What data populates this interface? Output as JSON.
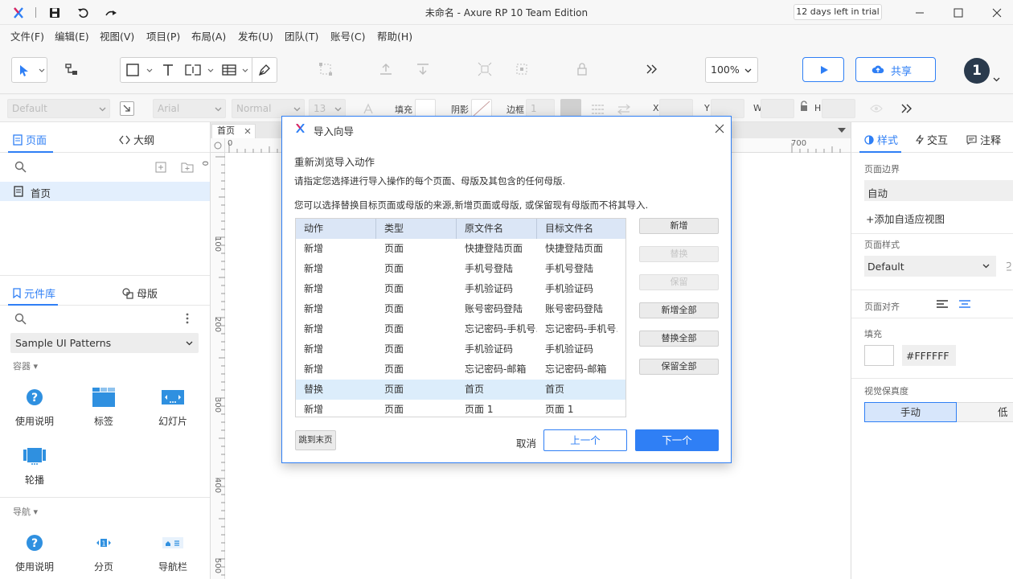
{
  "window": {
    "title": "未命名 - Axure RP 10 Team Edition",
    "trial": "12 days left in trial"
  },
  "menu": [
    "文件(F)",
    "编辑(E)",
    "视图(V)",
    "项目(P)",
    "布局(A)",
    "发布(U)",
    "团队(T)",
    "账号(C)",
    "帮助(H)"
  ],
  "toolbar": {
    "zoom": "100%",
    "share_label": "共享",
    "avatar_text": "1"
  },
  "style_toolbar": {
    "style_select": "Default",
    "font_select": "Arial",
    "weight_select": "Normal",
    "size_select": "13",
    "fill_label": "填充",
    "shadow_label": "阴影",
    "border_label": "边框",
    "border_value": "1",
    "x_label": "X",
    "y_label": "Y",
    "w_label": "W",
    "h_label": "H"
  },
  "left_panel": {
    "pages_tab": "页面",
    "outline_tab": "大纲",
    "pages": [
      "首页"
    ],
    "library_tab": "元件库",
    "masters_tab": "母版",
    "library_select": "Sample UI Patterns",
    "section_containers": "容器",
    "containers": [
      {
        "label": "使用说明",
        "icon": "help-circle-icon"
      },
      {
        "label": "标签",
        "icon": "tabs-icon"
      },
      {
        "label": "幻灯片",
        "icon": "slideshow-icon"
      },
      {
        "label": "轮播",
        "icon": "carousel-icon"
      }
    ],
    "section_nav": "导航",
    "nav_widgets": [
      {
        "label": "使用说明",
        "icon": "help-circle-icon"
      },
      {
        "label": "分页",
        "icon": "pagination-icon"
      },
      {
        "label": "导航栏",
        "icon": "navbar-icon"
      }
    ]
  },
  "canvas": {
    "page_tab": "首页",
    "ruler_h": [
      "0",
      "700"
    ],
    "ruler_v": [
      "0",
      "100",
      "200",
      "300",
      "400",
      "500"
    ]
  },
  "right_panel": {
    "tabs": [
      "样式",
      "交互",
      "注释"
    ],
    "page_bounds_label": "页面边界",
    "page_bounds_value": "自动",
    "add_adaptive_view": "+添加自适应视图",
    "page_style_label": "页面样式",
    "page_style_value": "Default",
    "page_align_label": "页面对齐",
    "fill_label": "填充",
    "fill_value": "#FFFFFF",
    "fidelity_label": "视觉保真度",
    "fidelity_options": [
      "手动",
      "低"
    ]
  },
  "dialog": {
    "title": "导入向导",
    "heading": "重新浏览导入动作",
    "desc1": "请指定您选择进行导入操作的每个页面、母版及其包含的任何母版.",
    "desc2": "您可以选择替换目标页面或母版的来源,新增页面或母版, 或保留现有母版而不将其导入.",
    "columns": [
      "动作",
      "类型",
      "原文件名",
      "目标文件名"
    ],
    "rows": [
      [
        "新增",
        "页面",
        "快捷登陆页面",
        "快捷登陆页面"
      ],
      [
        "新增",
        "页面",
        "手机号登陆",
        "手机号登陆"
      ],
      [
        "新增",
        "页面",
        "手机验证码",
        "手机验证码"
      ],
      [
        "新增",
        "页面",
        "账号密码登陆",
        "账号密码登陆"
      ],
      [
        "新增",
        "页面",
        "忘记密码-手机号...",
        "忘记密码-手机号..."
      ],
      [
        "新增",
        "页面",
        "手机验证码",
        "手机验证码"
      ],
      [
        "新增",
        "页面",
        "忘记密码-邮箱",
        "忘记密码-邮箱"
      ],
      [
        "替换",
        "页面",
        "首页",
        "首页"
      ],
      [
        "新增",
        "页面",
        "页面 1",
        "页面 1"
      ]
    ],
    "selected_row": 7,
    "side_buttons": [
      "新增",
      "替换",
      "保留",
      "新增全部",
      "替换全部",
      "保留全部"
    ],
    "jump_end": "跳到末页",
    "cancel": "取消",
    "prev": "上一个",
    "next": "下一个"
  },
  "colors": {
    "accent": "#2f7ff5",
    "header_bg": "#dbe6f6",
    "selected_row": "#dcedfb"
  }
}
